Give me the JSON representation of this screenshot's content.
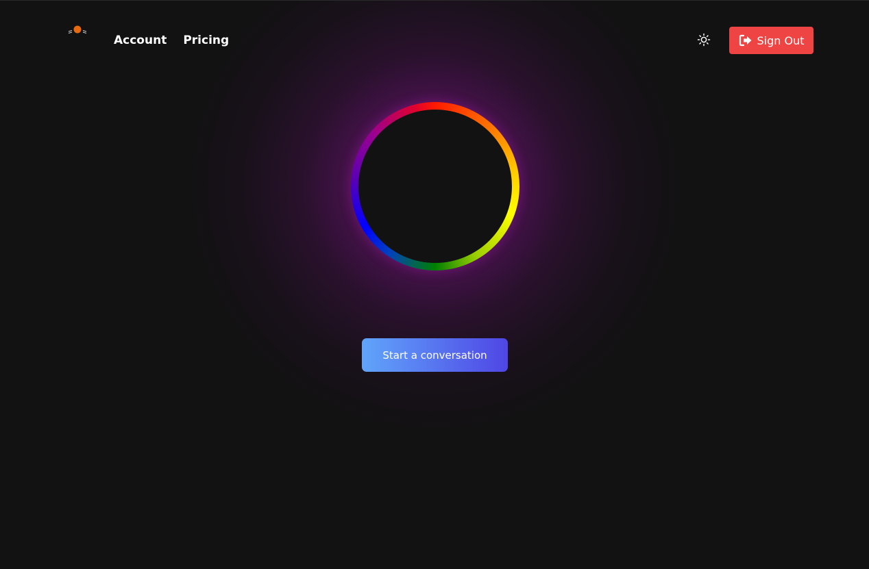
{
  "header": {
    "logo_icon": "cat-sun-logo-icon",
    "nav": [
      {
        "label": "Account"
      },
      {
        "label": "Pricing"
      }
    ],
    "theme_toggle_icon": "sun-icon",
    "sign_out": {
      "label": "Sign Out",
      "icon": "sign-out-icon",
      "color": "#ef4444"
    }
  },
  "main": {
    "ring_icon": "rainbow-ring",
    "cta_label": "Start a conversation",
    "cta_gradient": [
      "#60a5fa",
      "#4f46e5"
    ]
  },
  "colors": {
    "background": "#121212",
    "glow": "#8c1496",
    "logo_accent": "#e86a10"
  }
}
